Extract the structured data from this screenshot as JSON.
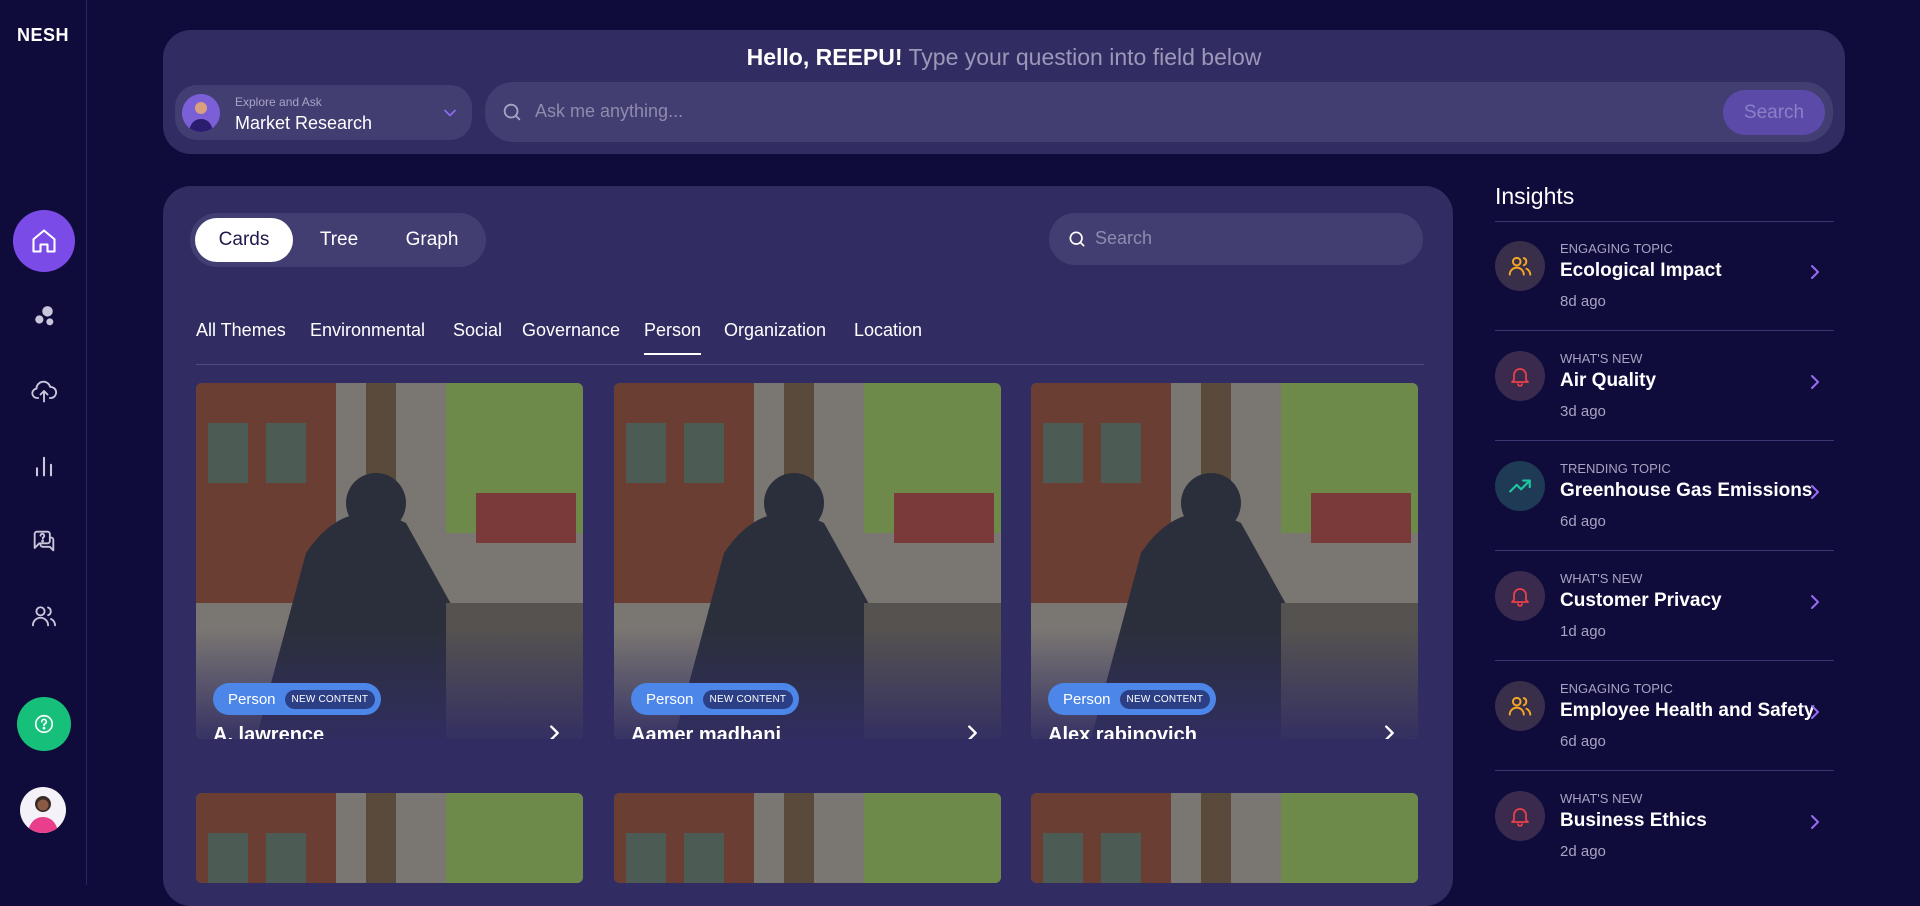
{
  "sidebar": {
    "logo": "NESH",
    "items": [
      {
        "icon": "home-icon",
        "active": true
      },
      {
        "icon": "bubbles-icon"
      },
      {
        "icon": "cloud-upload-icon"
      },
      {
        "icon": "bar-chart-icon"
      },
      {
        "icon": "question-chat-icon"
      },
      {
        "icon": "users-icon"
      }
    ],
    "help_icon": "help-icon",
    "avatar": "user-avatar"
  },
  "header": {
    "greeting_name": "Hello, REEPU!",
    "greeting_sub": "Type your question into field below",
    "explore_label": "Explore and Ask",
    "explore_value": "Market Research",
    "ask_placeholder": "Ask me anything...",
    "search_button": "Search"
  },
  "main": {
    "view_tabs": [
      {
        "label": "Cards",
        "active": true
      },
      {
        "label": "Tree"
      },
      {
        "label": "Graph"
      }
    ],
    "search_placeholder": "Search",
    "theme_tabs": [
      {
        "label": "All Themes"
      },
      {
        "label": "Environmental"
      },
      {
        "label": "Social"
      },
      {
        "label": "Governance"
      },
      {
        "label": "Person",
        "active": true
      },
      {
        "label": "Organization"
      },
      {
        "label": "Location"
      }
    ],
    "cards": [
      {
        "type": "Person",
        "badge": "NEW CONTENT",
        "name": "A. lawrence"
      },
      {
        "type": "Person",
        "badge": "NEW CONTENT",
        "name": "Aamer madhani"
      },
      {
        "type": "Person",
        "badge": "NEW CONTENT",
        "name": "Alex rabinovich"
      }
    ]
  },
  "insights": {
    "title": "Insights",
    "items": [
      {
        "category": "ENGAGING TOPIC",
        "title": "Ecological Impact",
        "time": "8d ago",
        "icon": "users-icon",
        "color": "#f5a623"
      },
      {
        "category": "WHAT'S NEW",
        "title": "Air Quality",
        "time": "3d ago",
        "icon": "bell-icon",
        "color": "#e8414a"
      },
      {
        "category": "TRENDING TOPIC",
        "title": "Greenhouse Gas Emissions",
        "time": "6d ago",
        "icon": "trending-up-icon",
        "color": "#1fc7a0"
      },
      {
        "category": "WHAT'S NEW",
        "title": "Customer Privacy",
        "time": "1d ago",
        "icon": "bell-icon",
        "color": "#e8414a"
      },
      {
        "category": "ENGAGING TOPIC",
        "title": "Employee Health and Safety",
        "time": "6d ago",
        "icon": "users-icon",
        "color": "#f5a623"
      },
      {
        "category": "WHAT'S NEW",
        "title": "Business Ethics",
        "time": "2d ago",
        "icon": "bell-icon",
        "color": "#e8414a"
      }
    ]
  }
}
